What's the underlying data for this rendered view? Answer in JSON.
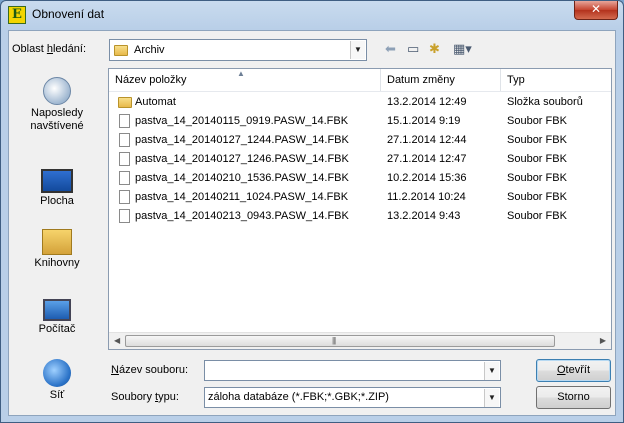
{
  "window": {
    "title": "Obnovení dat",
    "close_glyph": "✕",
    "app_icon_glyph": "E"
  },
  "lookin": {
    "label_pre": "Oblast ",
    "label_u": "h",
    "label_post": "ledání:",
    "value": "Archiv",
    "toolbar_icons": [
      "back-icon",
      "up-folder-icon",
      "new-folder-icon",
      "views-menu-icon"
    ]
  },
  "places": [
    {
      "label": "Naposledy navštívené",
      "icon": "recent-places-icon"
    },
    {
      "label": "Plocha",
      "icon": "desktop-icon"
    },
    {
      "label": "Knihovny",
      "icon": "libraries-icon"
    },
    {
      "label": "Počítač",
      "icon": "computer-icon"
    },
    {
      "label": "Síť",
      "icon": "network-icon"
    }
  ],
  "list": {
    "columns": [
      "Název položky",
      "Datum změny",
      "Typ"
    ],
    "rows": [
      {
        "name": "Automat",
        "date": "13.2.2014 12:49",
        "type": "Složka souborů",
        "kind": "folder"
      },
      {
        "name": "pastva_14_20140115_0919.PASW_14.FBK",
        "date": "15.1.2014 9:19",
        "type": "Soubor FBK",
        "kind": "file"
      },
      {
        "name": "pastva_14_20140127_1244.PASW_14.FBK",
        "date": "27.1.2014 12:44",
        "type": "Soubor FBK",
        "kind": "file"
      },
      {
        "name": "pastva_14_20140127_1246.PASW_14.FBK",
        "date": "27.1.2014 12:47",
        "type": "Soubor FBK",
        "kind": "file"
      },
      {
        "name": "pastva_14_20140210_1536.PASW_14.FBK",
        "date": "10.2.2014 15:36",
        "type": "Soubor FBK",
        "kind": "file"
      },
      {
        "name": "pastva_14_20140211_1024.PASW_14.FBK",
        "date": "11.2.2014 10:24",
        "type": "Soubor FBK",
        "kind": "file"
      },
      {
        "name": "pastva_14_20140213_0943.PASW_14.FBK",
        "date": "13.2.2014 9:43",
        "type": "Soubor FBK",
        "kind": "file"
      }
    ]
  },
  "filename": {
    "label_u": "N",
    "label_post": "ázev souboru:",
    "value": ""
  },
  "filetype": {
    "label_pre": "Soubory ",
    "label_u": "t",
    "label_post": "ypu:",
    "value": "záloha databáze (*.FBK;*.GBK;*.ZIP)"
  },
  "buttons": {
    "open_u": "O",
    "open_post": "tevřít",
    "cancel": "Storno"
  }
}
